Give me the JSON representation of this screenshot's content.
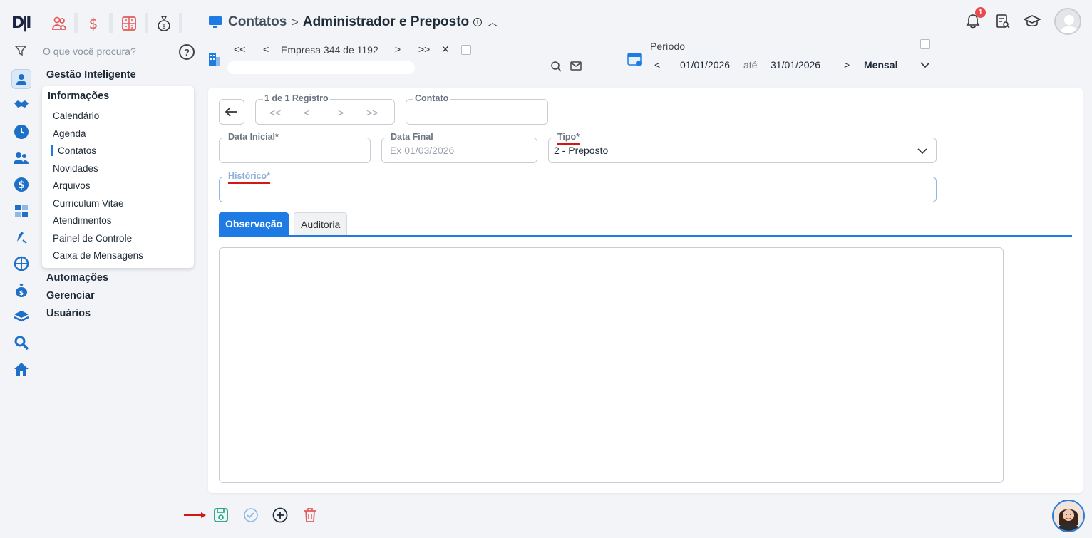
{
  "logo_text": "D|I",
  "search": {
    "placeholder": "O que você procura?",
    "help": "?"
  },
  "menu": {
    "gestao": "Gestão Inteligente",
    "info_title": "Informações",
    "items": [
      "Calendário",
      "Agenda",
      "Contatos",
      "Novidades",
      "Arquivos",
      "Curriculum Vitae",
      "Atendimentos",
      "Painel de Controle",
      "Caixa de Mensagens"
    ],
    "active_item": "Contatos",
    "automacoes": "Automações",
    "gerenciar": "Gerenciar",
    "usuarios": "Usuários"
  },
  "header": {
    "root": "Contatos",
    "sep": ">",
    "current": "Administrador e Preposto",
    "info": "i"
  },
  "company_nav": {
    "first": "<<",
    "prev": "<",
    "label": "Empresa 344 de 1192",
    "next": ">",
    "last": ">>",
    "clear": "✕"
  },
  "period": {
    "label": "Período",
    "prev": "<",
    "start": "01/01/2026",
    "until": "até",
    "end": "31/01/2026",
    "next": ">",
    "mode": "Mensal"
  },
  "notifications": {
    "count": "1"
  },
  "form": {
    "record_legend": "1 de 1 Registro",
    "rec_first": "<<",
    "rec_prev": "<",
    "rec_next": ">",
    "rec_last": ">>",
    "contato_legend": "Contato",
    "data_inicial_legend": "Data Inicial*",
    "data_final_legend": "Data Final",
    "data_final_placeholder": "Ex 01/03/2026",
    "tipo_legend": "Tipo*",
    "tipo_value": "2 - Preposto",
    "historico_legend": "Histórico*"
  },
  "tabs": {
    "observacao": "Observação",
    "auditoria": "Auditoria"
  },
  "colors": {
    "accent": "#1e7be4",
    "danger": "#e84b4b",
    "save": "#1aa37a"
  }
}
